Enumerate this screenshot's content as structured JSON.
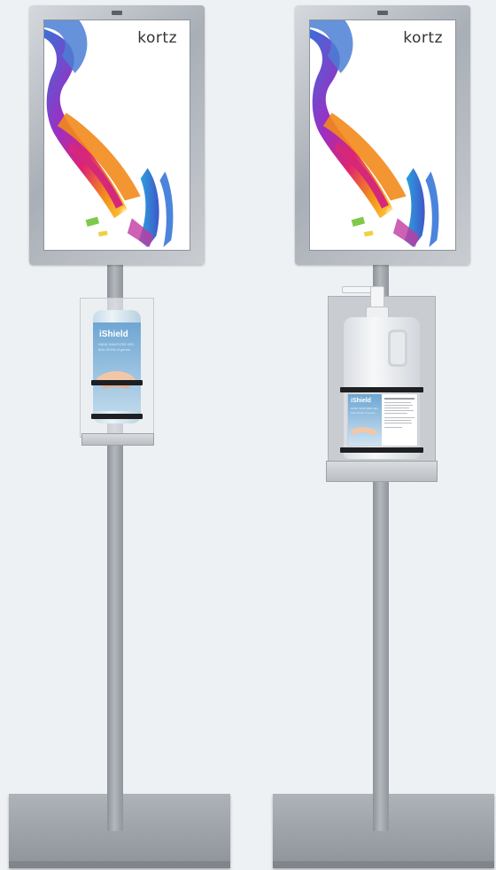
{
  "stands": [
    {
      "poster_brand": "kortz",
      "dispenser": "pump bottle",
      "bottle_label": {
        "brand": "iShield",
        "product": "HAND SANITIZER GEL",
        "tagline": "Kills 99.9% of germs"
      }
    },
    {
      "poster_brand": "kortz",
      "dispenser": "gallon pump jug",
      "bottle_label": {
        "brand": "iShield",
        "product": "HAND SANITIZER GEL",
        "tagline": "Kills 99.9% of germs"
      }
    }
  ],
  "colors": {
    "background": "#eef1f4",
    "metal": "#a9afb6",
    "poster_accent_orange": "#f28a1b",
    "poster_accent_magenta": "#d6287a",
    "poster_accent_blue": "#4a7fd4",
    "label_blue": "#6ea6d3",
    "strap": "#1d1f22"
  }
}
